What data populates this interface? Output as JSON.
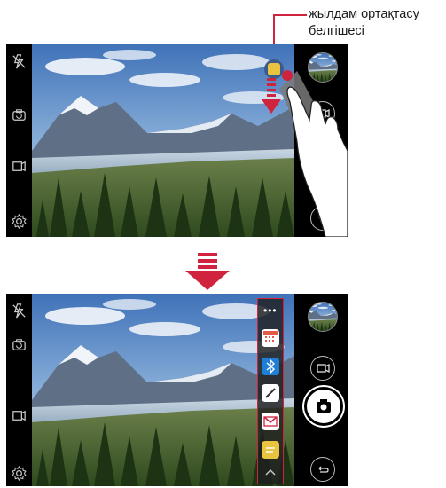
{
  "annotation": {
    "line1": "жылдам ортақтасу",
    "line2": "белгішесі"
  },
  "colors": {
    "accent_red": "#d0233d",
    "quickshare_yellow": "#e9c441",
    "screen_bg": "#000000"
  },
  "top_screen": {
    "left_icons": [
      "flash-off-icon",
      "switch-camera-icon",
      "mode-icon",
      "settings-icon"
    ],
    "right_icons": [
      "gallery-thumbnail",
      "video-record-icon",
      "back-icon"
    ],
    "overlay": [
      "quickshare-icon",
      "drag-down-arrow",
      "hand-gesture"
    ]
  },
  "bottom_screen": {
    "left_icons": [
      "flash-off-icon",
      "switch-camera-icon",
      "mode-icon",
      "settings-icon"
    ],
    "right_icons": [
      "gallery-thumbnail",
      "video-record-icon",
      "shutter-button",
      "back-icon"
    ],
    "tray_items": [
      "more-icon",
      "calendar-app-icon",
      "bluetooth-icon",
      "pen-app-icon",
      "gmail-icon",
      "quickshare-icon",
      "chevron-up-icon"
    ]
  }
}
